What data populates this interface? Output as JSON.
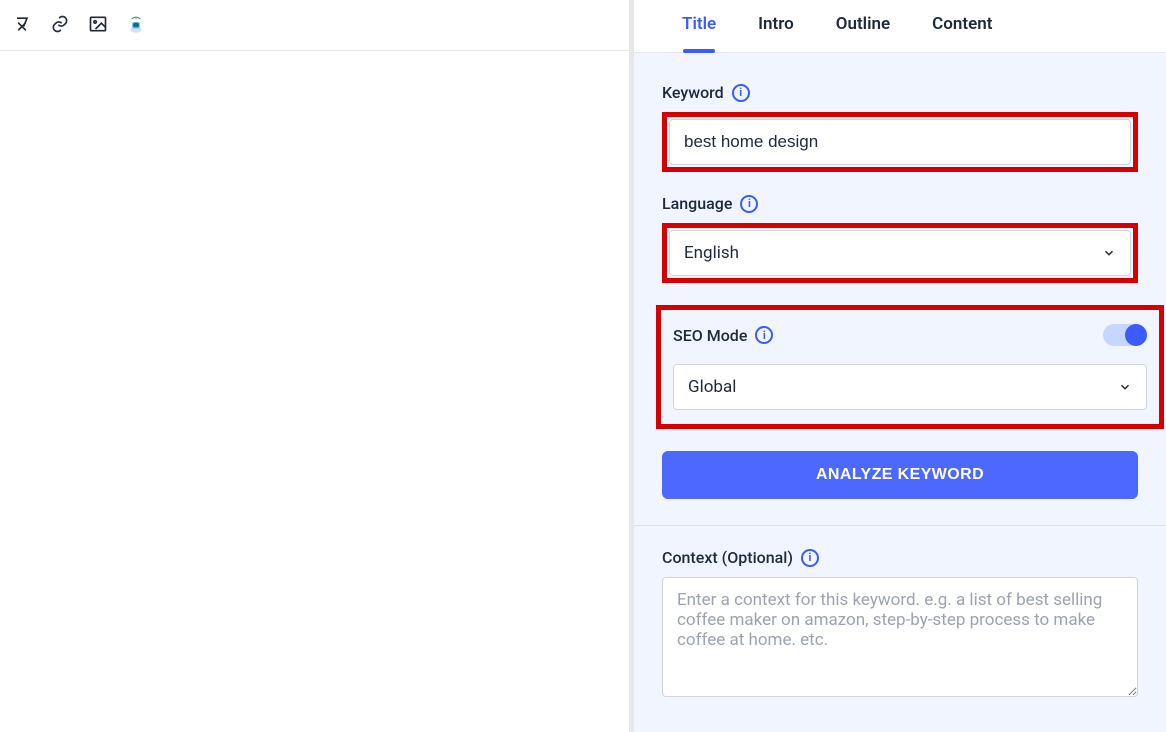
{
  "tabs": {
    "title": "Title",
    "intro": "Intro",
    "outline": "Outline",
    "content": "Content"
  },
  "keyword": {
    "label": "Keyword",
    "value": "best home design"
  },
  "language": {
    "label": "Language",
    "value": "English"
  },
  "seo": {
    "label": "SEO Mode",
    "enabled": true,
    "scope_value": "Global"
  },
  "analyze_button": "ANALYZE KEYWORD",
  "context": {
    "label": "Context (Optional)",
    "placeholder": "Enter a context for this keyword. e.g. a list of best selling coffee maker on amazon, step-by-step process to make coffee at home. etc."
  },
  "toolbar_icons": {
    "clear_format": "clear-format-icon",
    "link": "link-icon",
    "image": "image-icon",
    "robot": "robot-icon"
  }
}
